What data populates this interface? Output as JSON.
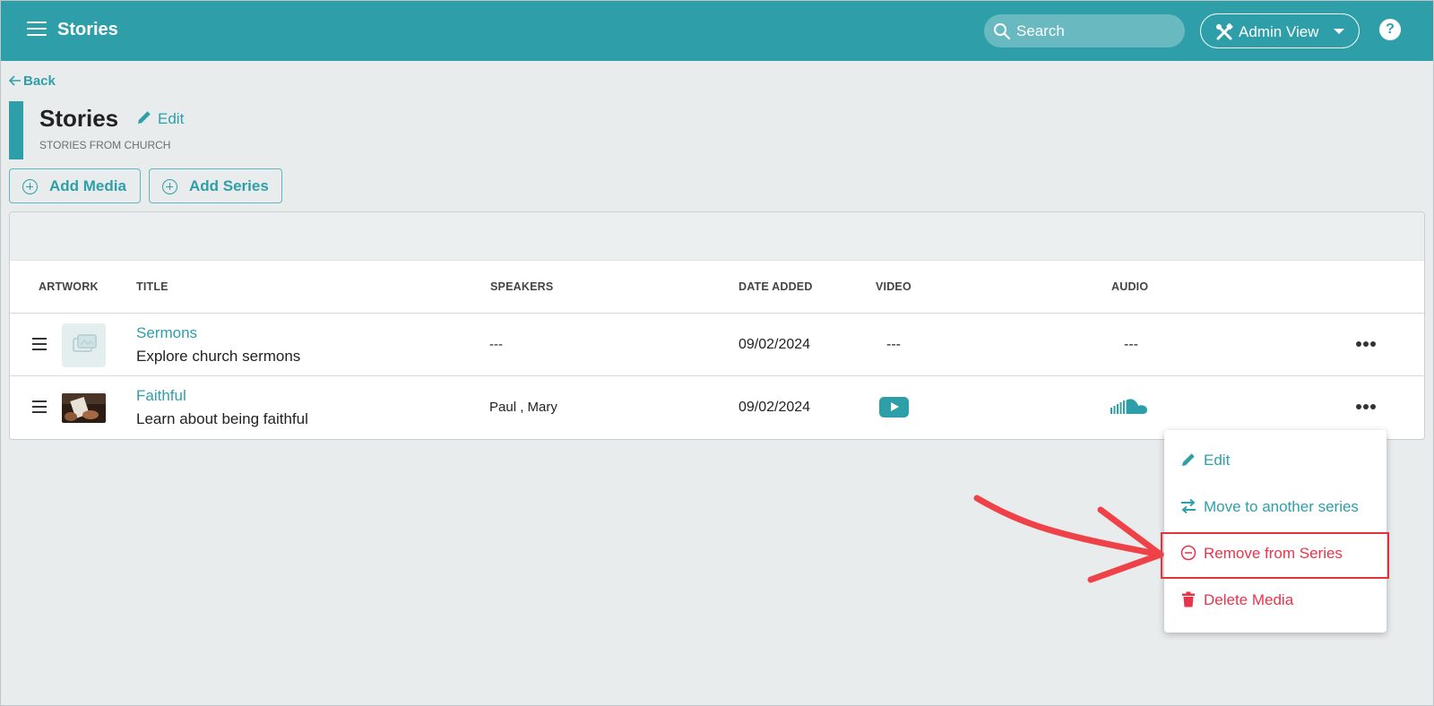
{
  "app": {
    "title": "Stories",
    "search_placeholder": "Search",
    "admin_view_label": "Admin View",
    "help_label": "?"
  },
  "header": {
    "back_label": "Back",
    "page_title": "Stories",
    "edit_label": "Edit",
    "subtitle": "STORIES FROM CHURCH"
  },
  "actions": {
    "add_media": "Add Media",
    "add_series": "Add Series"
  },
  "table": {
    "columns": [
      "ARTWORK",
      "TITLE",
      "SPEAKERS",
      "DATE ADDED",
      "VIDEO",
      "AUDIO"
    ],
    "rows": [
      {
        "title": "Sermons",
        "description": "Explore church sermons",
        "speakers": "---",
        "date_added": "09/02/2024",
        "video": "---",
        "audio": "---",
        "artwork": "placeholder-icon"
      },
      {
        "title": "Faithful",
        "description": "Learn about being faithful",
        "speakers": "Paul , Mary",
        "date_added": "09/02/2024",
        "video": "youtube-icon",
        "audio": "soundcloud-icon",
        "artwork": "photo-thumbnail"
      }
    ]
  },
  "context_menu": {
    "items": [
      {
        "label": "Edit",
        "icon": "pencil-icon"
      },
      {
        "label": "Move to another series",
        "icon": "swap-arrows-icon"
      },
      {
        "label": "Remove from Series",
        "icon": "minus-circle-icon"
      },
      {
        "label": "Delete Media",
        "icon": "trash-icon"
      }
    ]
  },
  "colors": {
    "brand": "#2e9fa8",
    "danger": "#e8344b",
    "annotation": "#ef4248"
  }
}
